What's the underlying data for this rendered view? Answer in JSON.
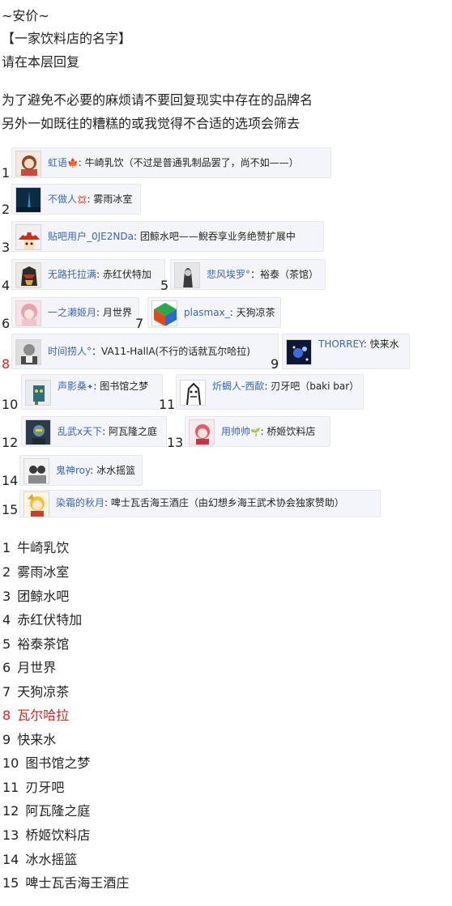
{
  "intro": {
    "line1": "~安价~",
    "line2": "【一家饮料店的名字】",
    "line3": "请在本层回复",
    "line4": "为了避免不必要的麻烦请不要回复现实中存在的品牌名",
    "line5": "另外一如既往的糟糕的或我觉得不合适的选项会筛去"
  },
  "entries": [
    {
      "num": "1",
      "user": "虹语",
      "badge": "🍁",
      "sep": ": ",
      "text": "牛崎乳饮（不过是普通乳制品罢了，尚不如——）",
      "red": false
    },
    {
      "num": "2",
      "user": "不做人",
      "badge": "💢",
      "sep": ": ",
      "text": "雾雨冰室",
      "red": false
    },
    {
      "num": "3",
      "user": "贴吧用户_0JE2NDa",
      "badge": "",
      "sep": ": ",
      "text": "团鲸水吧——鲵吞享业务绝赞扩展中",
      "red": false
    },
    {
      "num": "4",
      "user": "无路托拉满",
      "badge": "",
      "sep": ": ",
      "text": "赤红伏特加",
      "red": false
    },
    {
      "num": "5",
      "user": "悲风埃罗°",
      "badge": "",
      "sep": "：",
      "text": "裕泰（茶馆）",
      "red": false
    },
    {
      "num": "6",
      "user": "一之濑姬月",
      "badge": "",
      "sep": ": ",
      "text": "月世界",
      "red": false
    },
    {
      "num": "7",
      "user": "plasmax_",
      "badge": "",
      "sep": ": ",
      "text": "天狗凉茶",
      "red": false
    },
    {
      "num": "8",
      "user": "时间捞人°",
      "badge": "",
      "sep": "：",
      "text": "VA11-HallA(不行的话就瓦尔哈拉)",
      "red": true
    },
    {
      "num": "9",
      "user": "THORREY",
      "badge": "",
      "sep": ": ",
      "text": "快来水",
      "red": false
    },
    {
      "num": "10",
      "user": "声影桑",
      "badge": "✦",
      "sep": ": ",
      "text": "图书馆之梦",
      "red": false
    },
    {
      "num": "11",
      "user": "炘蝎人-西歃",
      "badge": "",
      "sep": ": ",
      "text": "刃牙吧（baki bar）",
      "red": false
    },
    {
      "num": "12",
      "user": "乱武x天下",
      "badge": "",
      "sep": ": ",
      "text": "阿瓦隆之庭",
      "red": false
    },
    {
      "num": "13",
      "user": "用帅帅",
      "badge": "🌱",
      "sep": ": ",
      "text": "桥姬饮料店",
      "red": false
    },
    {
      "num": "14",
      "user": "鬼神roy",
      "badge": "",
      "sep": ": ",
      "text": "冰水摇篮",
      "red": false
    },
    {
      "num": "15",
      "user": "染霜的秋月",
      "badge": "",
      "sep": ": ",
      "text": "啤士瓦舌海王酒庄（由幻想乡海王武术协会独家赞助）",
      "red": false
    }
  ],
  "list": [
    {
      "num": "1",
      "name": "牛崎乳饮",
      "red": false
    },
    {
      "num": "2",
      "name": "雾雨冰室",
      "red": false
    },
    {
      "num": "3",
      "name": "团鲸水吧",
      "red": false
    },
    {
      "num": "4",
      "name": "赤红伏特加",
      "red": false
    },
    {
      "num": "5",
      "name": "裕泰茶馆",
      "red": false
    },
    {
      "num": "6",
      "name": "月世界",
      "red": false
    },
    {
      "num": "7",
      "name": "天狗凉茶",
      "red": false
    },
    {
      "num": "8",
      "name": "瓦尔哈拉",
      "red": true
    },
    {
      "num": "9",
      "name": "快来水",
      "red": false
    },
    {
      "num": "10",
      "name": "图书馆之梦",
      "red": false
    },
    {
      "num": "11",
      "name": "刃牙吧",
      "red": false
    },
    {
      "num": "12",
      "name": "阿瓦隆之庭",
      "red": false
    },
    {
      "num": "13",
      "name": "桥姬饮料店",
      "red": false
    },
    {
      "num": "14",
      "name": "冰水摇篮",
      "red": false
    },
    {
      "num": "15",
      "name": "啤士瓦舌海王酒庄",
      "red": false
    }
  ]
}
